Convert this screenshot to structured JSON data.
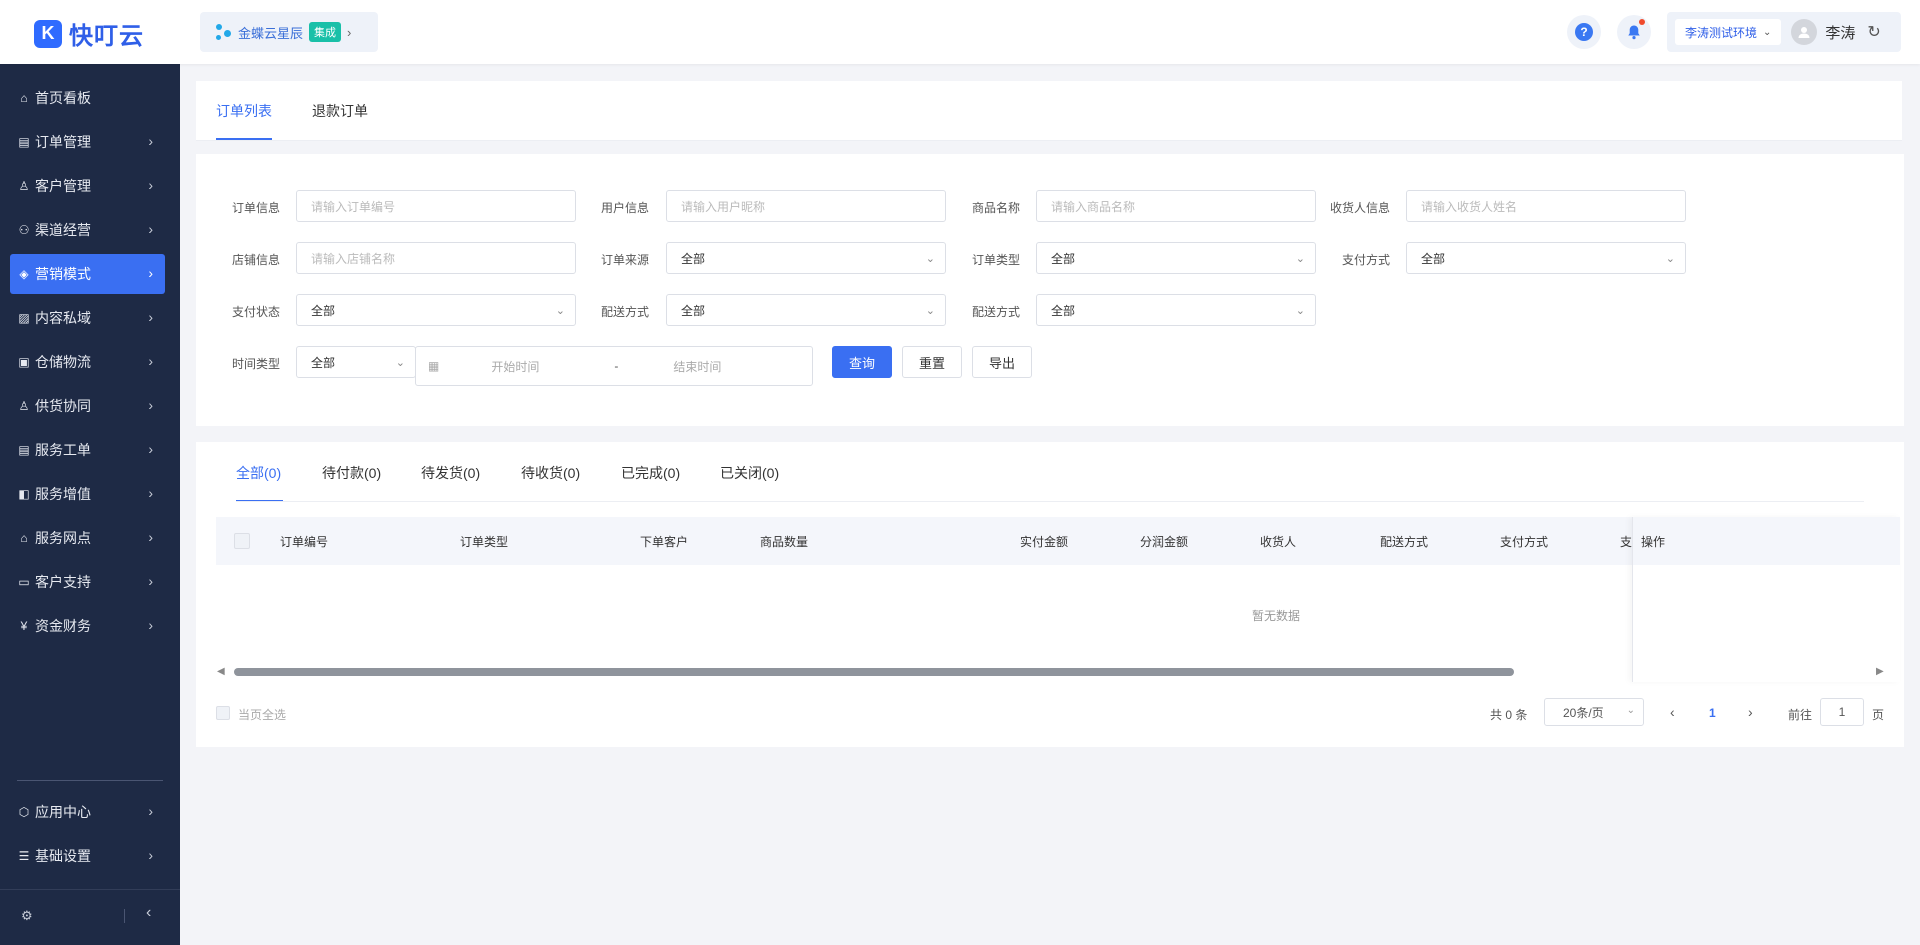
{
  "brand": {
    "logo_text": "快叮云",
    "logo_icon": "k-logo-icon"
  },
  "integration": {
    "name": "金蝶云星辰",
    "badge": "集成",
    "arrow": "›"
  },
  "header": {
    "help": "?",
    "env": "李涛测试环境",
    "user": "李涛",
    "refresh": "↻"
  },
  "sidebar": {
    "items": [
      {
        "label": "首页看板",
        "icon": "home-icon"
      },
      {
        "label": "订单管理",
        "icon": "order-icon"
      },
      {
        "label": "客户管理",
        "icon": "user-icon"
      },
      {
        "label": "渠道经营",
        "icon": "channel-icon"
      },
      {
        "label": "营销模式",
        "icon": "marketing-icon"
      },
      {
        "label": "内容私域",
        "icon": "content-icon"
      },
      {
        "label": "仓储物流",
        "icon": "warehouse-icon"
      },
      {
        "label": "供货协同",
        "icon": "supply-icon"
      },
      {
        "label": "服务工单",
        "icon": "ticket-icon"
      },
      {
        "label": "服务增值",
        "icon": "value-icon"
      },
      {
        "label": "服务网点",
        "icon": "store-icon"
      },
      {
        "label": "客户支持",
        "icon": "support-icon"
      },
      {
        "label": "资金财务",
        "icon": "finance-icon"
      }
    ],
    "bottom_items": [
      {
        "label": "应用中心",
        "icon": "app-center-icon"
      },
      {
        "label": "基础设置",
        "icon": "settings-icon"
      }
    ]
  },
  "tabs": [
    "订单列表",
    "退款订单"
  ],
  "filters": {
    "order_info": {
      "label": "订单信息",
      "placeholder": "请输入订单编号"
    },
    "user_info": {
      "label": "用户信息",
      "placeholder": "请输入用户昵称"
    },
    "product_name": {
      "label": "商品名称",
      "placeholder": "请输入商品名称"
    },
    "receiver_info": {
      "label": "收货人信息",
      "placeholder": "请输入收货人姓名"
    },
    "store_info": {
      "label": "店铺信息",
      "placeholder": "请输入店铺名称"
    },
    "order_source": {
      "label": "订单来源",
      "value": "全部"
    },
    "order_type": {
      "label": "订单类型",
      "value": "全部"
    },
    "pay_method": {
      "label": "支付方式",
      "value": "全部"
    },
    "pay_status": {
      "label": "支付状态",
      "value": "全部"
    },
    "delivery_method_1": {
      "label": "配送方式",
      "value": "全部"
    },
    "delivery_method_2": {
      "label": "配送方式",
      "value": "全部"
    },
    "time_type": {
      "label": "时间类型",
      "value": "全部"
    },
    "start_time": "开始时间",
    "end_time": "结束时间",
    "range_sep": "-"
  },
  "buttons": {
    "query": "查询",
    "reset": "重置",
    "export": "导出"
  },
  "status_tabs": [
    "全部(0)",
    "待付款(0)",
    "待发货(0)",
    "待收货(0)",
    "已完成(0)",
    "已关闭(0)"
  ],
  "table": {
    "columns": [
      "订单编号",
      "订单类型",
      "下单客户",
      "商品数量",
      "实付金额",
      "分润金额",
      "收货人",
      "配送方式",
      "支付方式",
      "支",
      "操作"
    ],
    "empty": "暂无数据"
  },
  "footer": {
    "select_all": "当页全选",
    "total": "共 0 条",
    "page_size": "20条/页",
    "current_page": "1",
    "goto_label": "前往",
    "goto_value": "1",
    "page_unit": "页"
  },
  "colors": {
    "accent": "#3a6ff2",
    "sidebar": "#1e2a45",
    "badge": "#19c0a8"
  }
}
